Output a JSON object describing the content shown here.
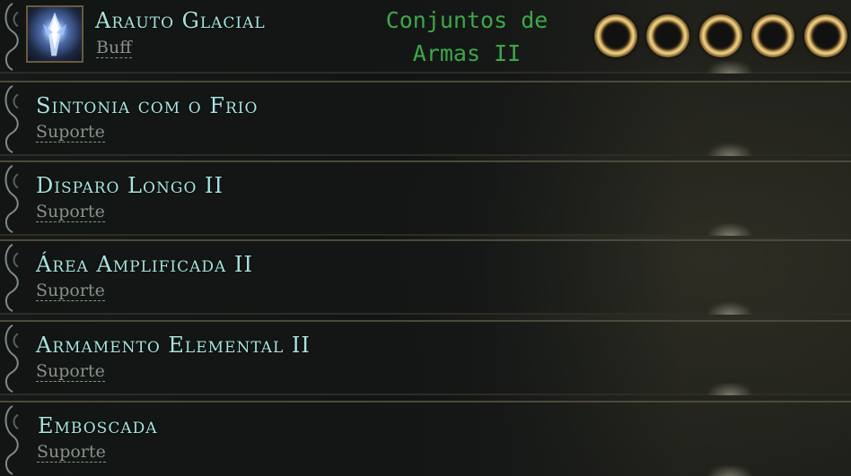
{
  "annotation": "Conjuntos de\nArmas II",
  "skill": {
    "name": "Arauto Glacial",
    "type": "Buff",
    "icon": "ice-crystal-icon"
  },
  "sockets": [
    {
      "state": "empty"
    },
    {
      "state": "empty"
    },
    {
      "state": "empty"
    },
    {
      "state": "empty"
    },
    {
      "state": "empty"
    }
  ],
  "supports": [
    {
      "name": "Sintonia com o Frio",
      "type": "Suporte"
    },
    {
      "name": "Disparo Longo II",
      "type": "Suporte"
    },
    {
      "name": "Área Amplificada II",
      "type": "Suporte"
    },
    {
      "name": "Armamento Elemental II",
      "type": "Suporte"
    },
    {
      "name": "Emboscada",
      "type": "Suporte"
    }
  ],
  "colors": {
    "gem_name": "#a8e4e0",
    "gem_type": "#8a9188",
    "annotation": "#3ea64a",
    "socket_gold": "#c8a35a"
  }
}
